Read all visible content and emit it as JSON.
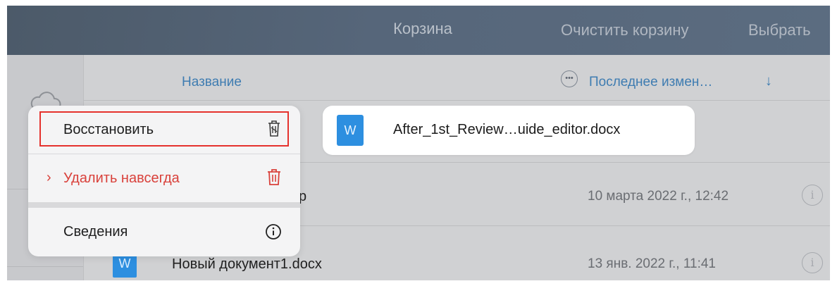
{
  "navbar": {
    "title": "Корзина",
    "clear_label": "Очистить корзину",
    "select_label": "Выбрать"
  },
  "columns": {
    "name": "Название",
    "more_icon": "ellipsis-icon",
    "modified": "Последнее измен…",
    "sort_indicator": "↓"
  },
  "preview": {
    "icon": "word-doc-icon",
    "icon_letter": "W",
    "file_name": "After_1st_Review…uide_editor.docx"
  },
  "files": [
    {
      "name_visible": "р",
      "date": "10 марта 2022 г., 12:42",
      "icon": "word-doc-icon"
    },
    {
      "name_visible": "Новый документ1.docx",
      "date": "13 янв. 2022 г., 11:41",
      "icon": "word-doc-icon",
      "icon_letter": "W"
    }
  ],
  "context_menu": {
    "items": [
      {
        "label": "Восстановить",
        "icon": "restore-trash-icon",
        "highlighted": true
      },
      {
        "label": "Удалить навсегда",
        "icon": "trash-icon",
        "chevron": "›",
        "destructive": true
      },
      {
        "label": "Сведения",
        "icon": "info-circle-icon"
      }
    ]
  },
  "colors": {
    "navbar": "#56667a",
    "accent_blue": "#3e7cb1",
    "destructive_red": "#d9413b",
    "highlight_border": "#e5322d",
    "word_blue": "#2d8fe0"
  }
}
